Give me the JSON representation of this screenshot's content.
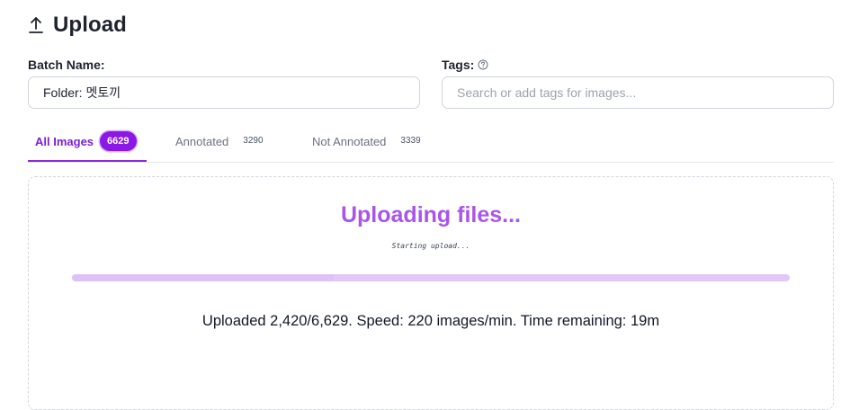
{
  "header": {
    "icon": "upload-arrow-icon",
    "title": "Upload"
  },
  "batch": {
    "label": "Batch Name:",
    "value": "Folder: 멧토끼"
  },
  "tags": {
    "label": "Tags:",
    "help_icon": "question-circle-icon",
    "placeholder": "Search or add tags for images..."
  },
  "tabs": [
    {
      "label": "All Images",
      "count": "6629",
      "active": true
    },
    {
      "label": "Annotated",
      "count": "3290",
      "active": false
    },
    {
      "label": "Not Annotated",
      "count": "3339",
      "active": false
    }
  ],
  "upload": {
    "title": "Uploading files...",
    "status": "Starting upload...",
    "progress": 0.365,
    "stats": "Uploaded 2,420/6,629. Speed: 220 images/min. Time remaining: 19m"
  },
  "colors": {
    "accent": "#8b18e6",
    "title": "#a955ec",
    "progress": "#e3c7f6"
  }
}
